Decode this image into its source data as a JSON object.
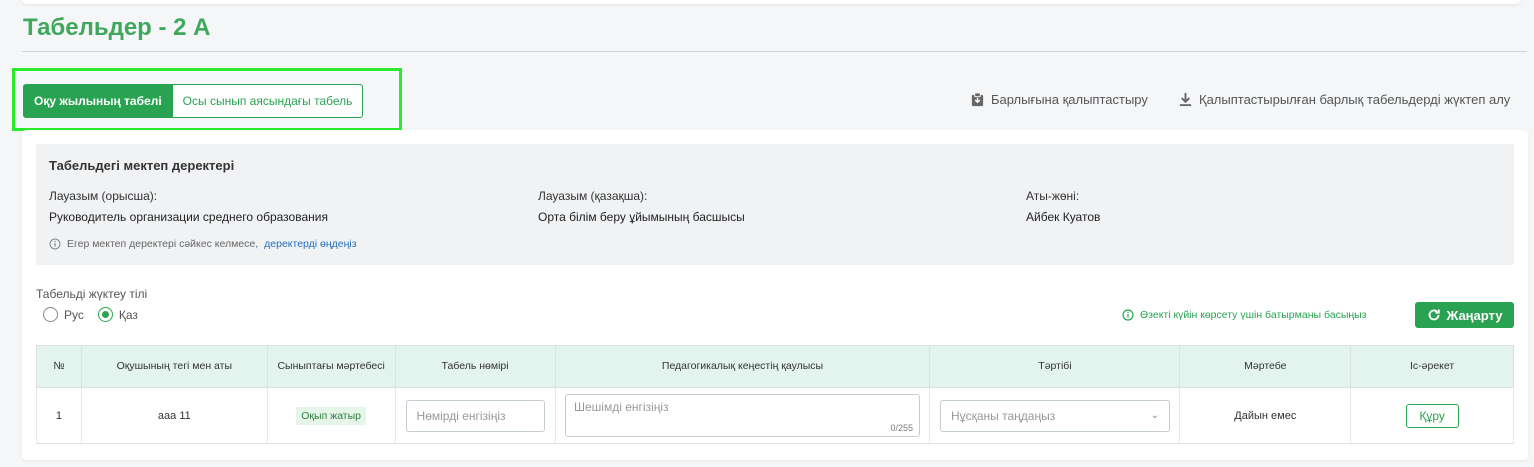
{
  "page": {
    "title": "Табельдер - 2 А"
  },
  "tabs": [
    {
      "label": "Оқу жылының табелі",
      "active": true
    },
    {
      "label": "Осы сынып аясындағы табель",
      "active": false
    }
  ],
  "top_actions": {
    "restore_all": "Барлығына қалыптастыру",
    "download_all": "Қалыптастырылған барлық табельдерді жүктеп алу"
  },
  "director": {
    "heading": "Табельдегі мектеп деректері",
    "position_ru_label": "Лауазым (орысша):",
    "position_ru_value": "Руководитель организации среднего образования",
    "position_kz_label": "Лауазым (қазақша):",
    "position_kz_value": "Орта білім беру ұйымының басшысы",
    "name_label": "Аты-жөні:",
    "name_value": "Айбек Куатов",
    "note_text": "Егер мектеп деректері сәйкес келмесе,",
    "note_link": "деректерді өңдеңіз"
  },
  "language": {
    "label": "Табельді жүктеу тілі",
    "options": [
      {
        "label": "Рус",
        "checked": false
      },
      {
        "label": "Қаз",
        "checked": true
      }
    ]
  },
  "refresh": {
    "hint": "Өзекті күйін көрсету үшін батырманы басыңыз",
    "button": "Жаңарту"
  },
  "table": {
    "headers": [
      "№",
      "Оқушының тегі мен аты",
      "Сыныптағы мәртебесі",
      "Табель нөмірі",
      "Педагогикалық кеңестің қаулысы",
      "Тәртібі",
      "Мәртебе",
      "Іс-әрекет"
    ],
    "rows": [
      {
        "num": "1",
        "student": "ааа 11",
        "class_status": "Оқып жатыр",
        "tabel_placeholder": "Нөмірді енгізіңіз",
        "decision_placeholder": "Шешімді енгізіңіз",
        "decision_counter": "0/255",
        "conduct_placeholder": "Нұсқаны таңдаңыз",
        "status": "Дайын емес",
        "action": "Құру"
      }
    ]
  },
  "colors": {
    "accent": "#29a352",
    "title": "#3fa85c",
    "header_bg": "#e3f4ef",
    "highlight": "#2bea2b"
  }
}
